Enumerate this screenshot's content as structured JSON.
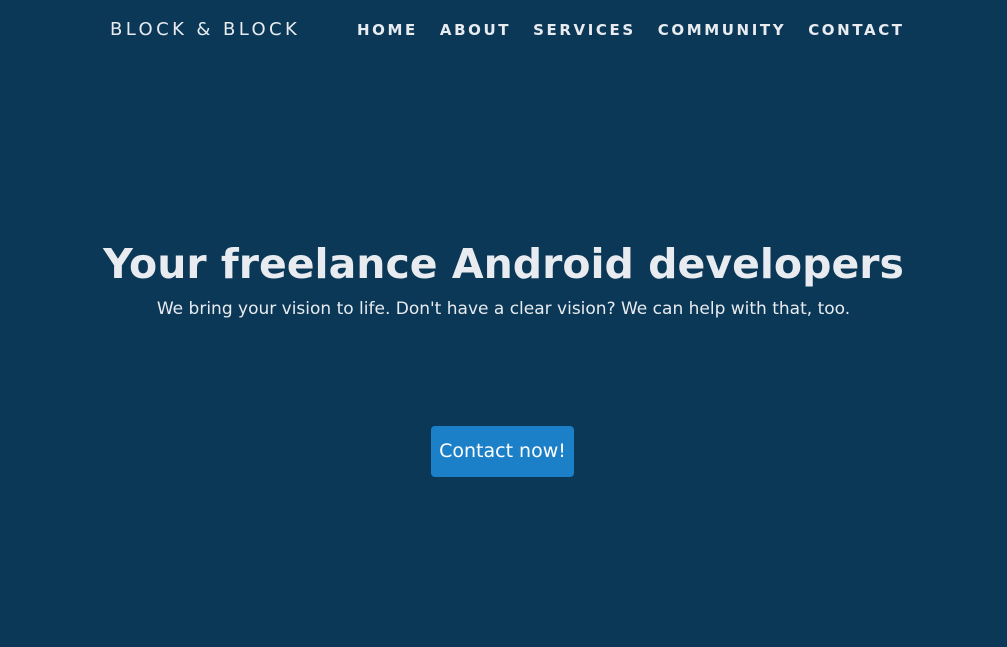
{
  "header": {
    "brand": "BLOCK & BLOCK",
    "nav": [
      {
        "label": "HOME"
      },
      {
        "label": "ABOUT"
      },
      {
        "label": "SERVICES"
      },
      {
        "label": "COMMUNITY"
      },
      {
        "label": "CONTACT"
      }
    ]
  },
  "hero": {
    "title": "Your freelance Android developers",
    "subtitle": "We bring your vision to life. Don't have a clear vision? We can help with that, too.",
    "cta_label": "Contact now!"
  },
  "colors": {
    "background": "#0b3857",
    "text": "#e8ebef",
    "button": "#1b80c8"
  }
}
